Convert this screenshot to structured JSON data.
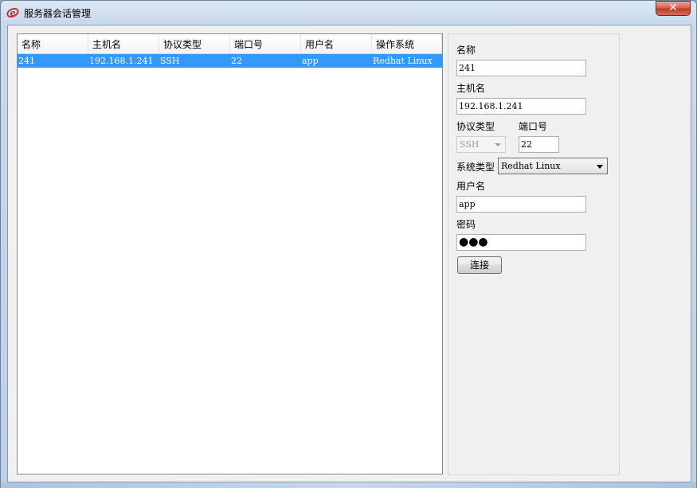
{
  "window": {
    "title": "服务器会话管理",
    "close_symbol": "✕"
  },
  "list": {
    "columns": [
      "名称",
      "主机名",
      "协议类型",
      "端口号",
      "用户名",
      "操作系统"
    ],
    "rows": [
      {
        "name": "241",
        "host": "192.168.1.241",
        "protocol": "SSH",
        "port": "22",
        "user": "app",
        "os": "Redhat Linux"
      }
    ]
  },
  "form": {
    "name_label": "名称",
    "name_value": "241",
    "host_label": "主机名",
    "host_value": "192.168.1.241",
    "protocol_label": "协议类型",
    "protocol_value": "SSH",
    "port_label": "端口号",
    "port_value": "22",
    "os_label": "系统类型",
    "os_value": "Redhat Linux",
    "user_label": "用户名",
    "user_value": "app",
    "password_label": "密码",
    "password_mask": "●●●",
    "connect_button": "连接"
  },
  "colors": {
    "selection": "#3399ff",
    "close_button": "#c8462e"
  }
}
